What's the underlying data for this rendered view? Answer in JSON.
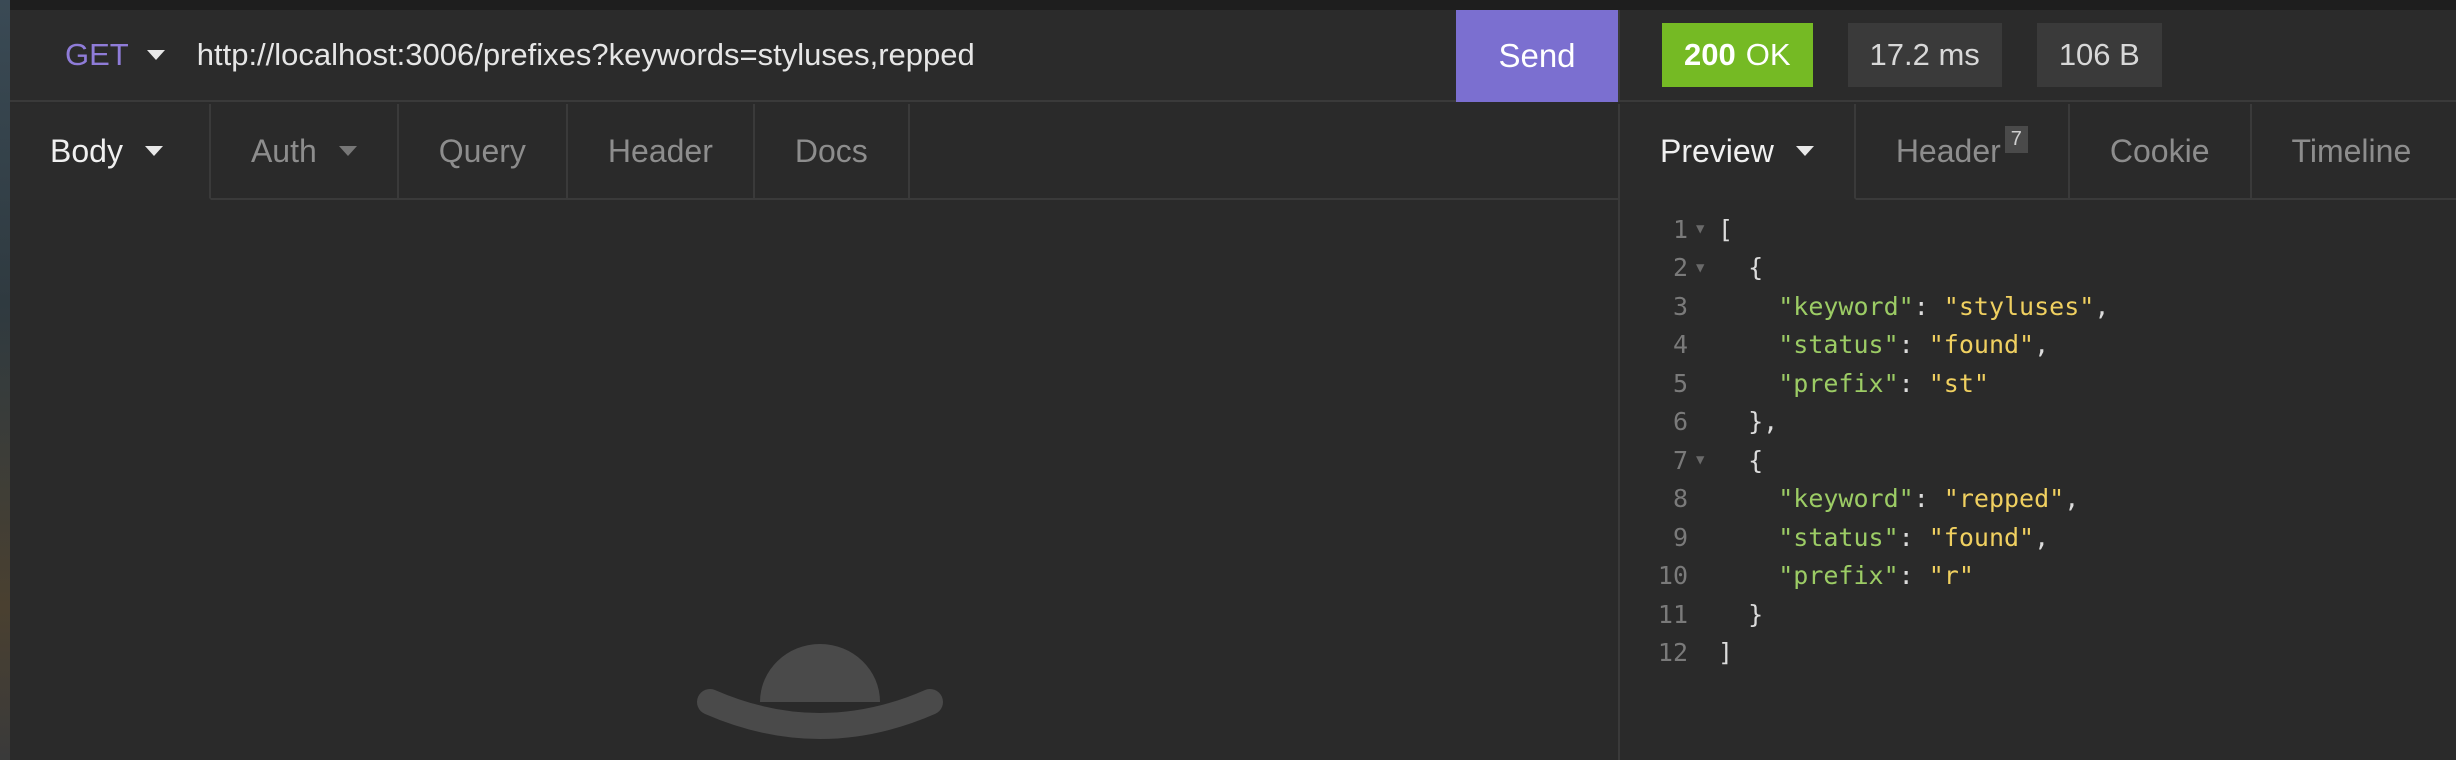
{
  "request": {
    "method": "GET",
    "url": "http://localhost:3006/prefixes?keywords=styluses,repped",
    "send_label": "Send",
    "tabs": [
      {
        "label": "Body",
        "active": true
      },
      {
        "label": "Auth",
        "active": false
      },
      {
        "label": "Query",
        "active": false
      },
      {
        "label": "Header",
        "active": false
      },
      {
        "label": "Docs",
        "active": false
      }
    ]
  },
  "response": {
    "status_code": "200",
    "status_text": "OK",
    "time": "17.2 ms",
    "size": "106 B",
    "tabs": [
      {
        "label": "Preview",
        "active": true
      },
      {
        "label": "Header",
        "badge": "7"
      },
      {
        "label": "Cookie"
      },
      {
        "label": "Timeline"
      }
    ],
    "lines": [
      {
        "n": "1",
        "fold": true,
        "text": "["
      },
      {
        "n": "2",
        "fold": true,
        "text": "  {"
      },
      {
        "n": "3",
        "key": "\"keyword\"",
        "val": "\"styluses\"",
        "trail": ","
      },
      {
        "n": "4",
        "key": "\"status\"",
        "val": "\"found\"",
        "trail": ","
      },
      {
        "n": "5",
        "key": "\"prefix\"",
        "val": "\"st\"",
        "trail": ""
      },
      {
        "n": "6",
        "text": "  },"
      },
      {
        "n": "7",
        "fold": true,
        "text": "  {"
      },
      {
        "n": "8",
        "key": "\"keyword\"",
        "val": "\"repped\"",
        "trail": ","
      },
      {
        "n": "9",
        "key": "\"status\"",
        "val": "\"found\"",
        "trail": ","
      },
      {
        "n": "10",
        "key": "\"prefix\"",
        "val": "\"r\"",
        "trail": ""
      },
      {
        "n": "11",
        "text": "  }"
      },
      {
        "n": "12",
        "text": "]"
      }
    ]
  },
  "colors": {
    "accent": "#7b6fd0",
    "ok": "#75ba24",
    "json_key": "#9ccc65",
    "json_value": "#f0d060"
  },
  "icons": {
    "method_dropdown": "chevron-down-icon",
    "empty_state": "hat-icon"
  }
}
